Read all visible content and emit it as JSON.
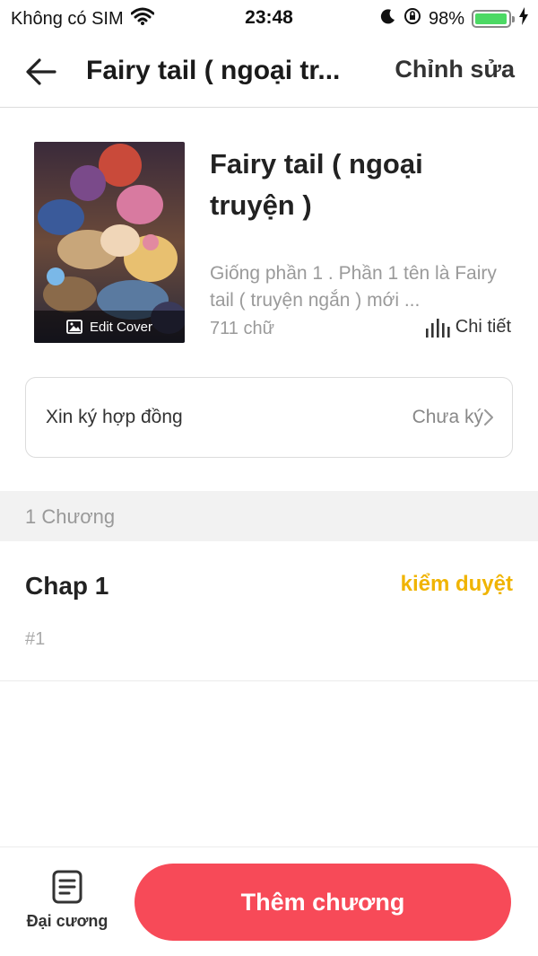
{
  "status_bar": {
    "carrier": "Không có SIM",
    "time": "23:48",
    "battery_percent": "98%",
    "battery_level": 0.98,
    "battery_color": "#4cd964"
  },
  "nav": {
    "back_icon": "arrow-left-icon",
    "title": "Fairy tail ( ngoại tr...",
    "edit_label": "Chỉnh sửa"
  },
  "book": {
    "cover_edit_label": "Edit Cover",
    "title": "Fairy tail ( ngoại truyện )",
    "description": "Giống phần 1 . Phần 1 tên là Fairy tail ( truyện ngắn ) mới ...",
    "word_count": "711 chữ",
    "detail_label": "Chi tiết"
  },
  "contract": {
    "label": "Xin ký hợp đồng",
    "status": "Chưa ký"
  },
  "chapters": {
    "count_label": "1 Chương",
    "items": [
      {
        "title": "Chap 1",
        "status": "kiểm duyệt",
        "number": "#1"
      }
    ]
  },
  "bottom": {
    "outline_label": "Đại cương",
    "add_chapter_label": "Thêm chương",
    "accent_color": "#f74a58",
    "status_color": "#f0b400"
  }
}
